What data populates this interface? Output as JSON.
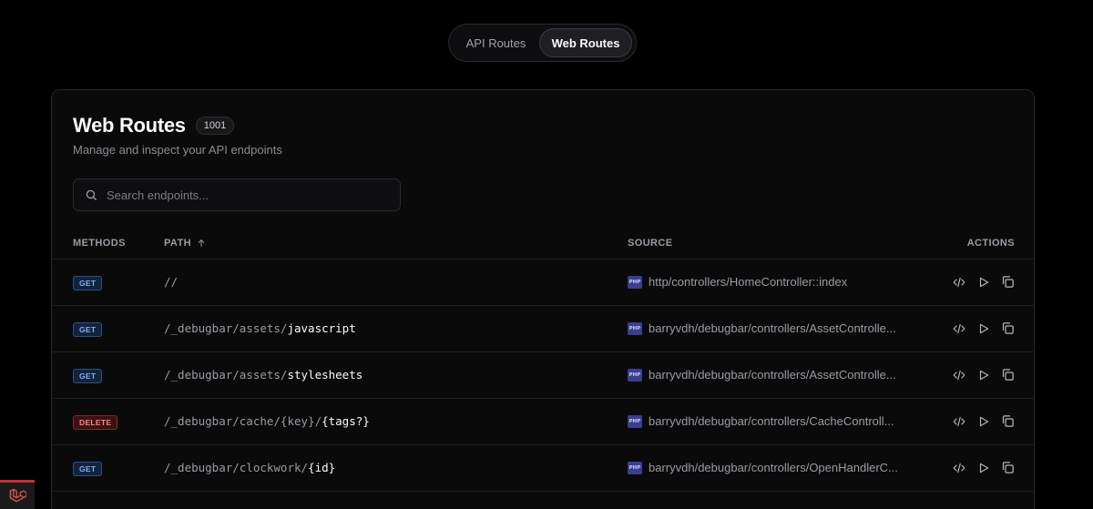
{
  "tabs": [
    {
      "label": "API Routes",
      "active": false
    },
    {
      "label": "Web Routes",
      "active": true
    }
  ],
  "header": {
    "title": "Web Routes",
    "count": "1001",
    "subtitle": "Manage and inspect your API endpoints"
  },
  "search": {
    "placeholder": "Search endpoints..."
  },
  "columns": {
    "methods": "METHODS",
    "path": "PATH",
    "source": "SOURCE",
    "actions": "ACTIONS"
  },
  "php_label": "PHP",
  "rows": [
    {
      "method": "GET",
      "path_prefix": "//",
      "path_last": "",
      "source": "http/controllers/HomeController::index"
    },
    {
      "method": "GET",
      "path_prefix": "/_debugbar/assets/",
      "path_last": "javascript",
      "source": "barryvdh/debugbar/controllers/AssetControlle..."
    },
    {
      "method": "GET",
      "path_prefix": "/_debugbar/assets/",
      "path_last": "stylesheets",
      "source": "barryvdh/debugbar/controllers/AssetControlle..."
    },
    {
      "method": "DELETE",
      "path_prefix": "/_debugbar/cache/{key}/",
      "path_last": "{tags?}",
      "source": "barryvdh/debugbar/controllers/CacheControll..."
    },
    {
      "method": "GET",
      "path_prefix": "/_debugbar/clockwork/",
      "path_last": "{id}",
      "source": "barryvdh/debugbar/controllers/OpenHandlerC..."
    }
  ],
  "colors": {
    "get": "#7fb0ff",
    "delete": "#ff8585",
    "laravel": "#c53030"
  }
}
